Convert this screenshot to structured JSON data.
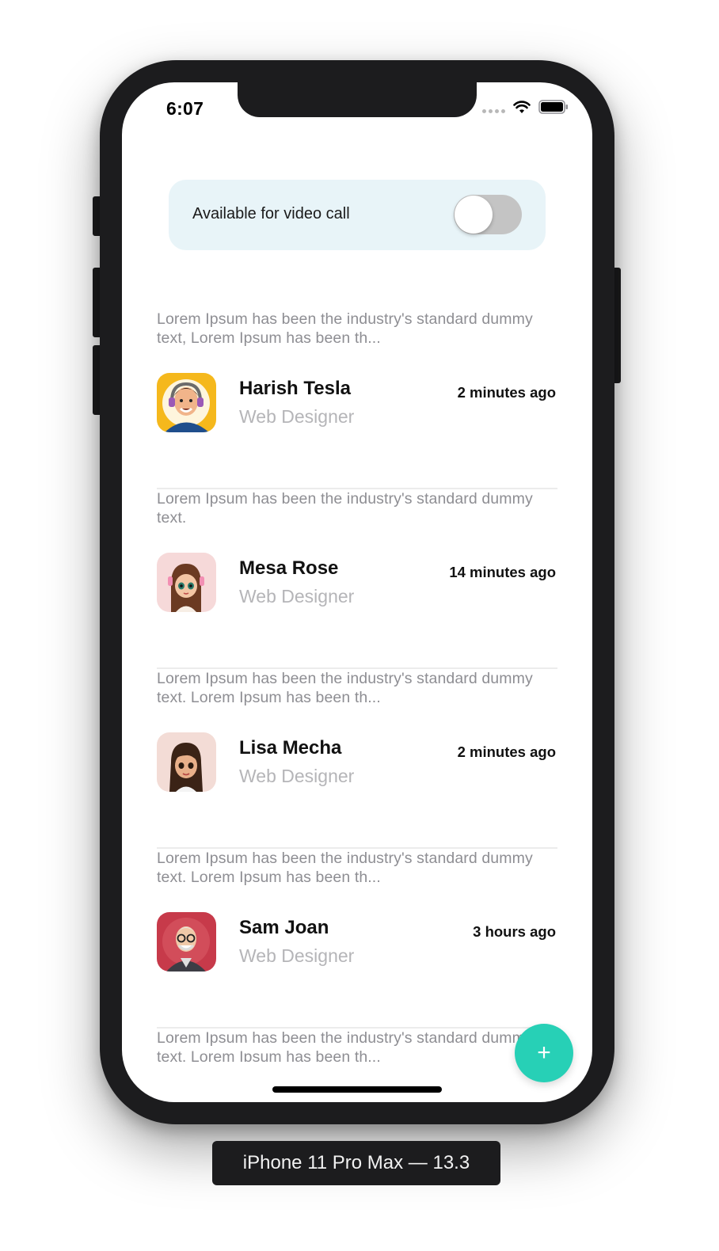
{
  "status_bar": {
    "time": "6:07",
    "icons": [
      "signal-dots-icon",
      "wifi-icon",
      "battery-icon"
    ]
  },
  "video_call_toggle": {
    "label": "Available for video call",
    "enabled": false
  },
  "feed": [
    {
      "preview": "Lorem Ipsum has been the industry's standard dummy text, Lorem Ipsum has been th...",
      "name": "Harish Tesla",
      "role": "Web Designer",
      "time": "2 minutes ago",
      "avatar": "avatar-man-headphones-icon"
    },
    {
      "preview": "Lorem Ipsum has been the industry's standard dummy text.",
      "name": "Mesa Rose",
      "role": "Web Designer",
      "time": "14 minutes ago",
      "avatar": "avatar-girl-headphones-icon"
    },
    {
      "preview": "Lorem Ipsum has been the industry's standard dummy text. Lorem Ipsum has been th...",
      "name": "Lisa Mecha",
      "role": "Web Designer",
      "time": "2 minutes ago",
      "avatar": "avatar-girl-icon"
    },
    {
      "preview": "Lorem Ipsum has been the industry's standard dummy text. Lorem Ipsum has been th...",
      "name": "Sam Joan",
      "role": "Web Designer",
      "time": "3 hours ago",
      "avatar": "avatar-man-glasses-icon"
    },
    {
      "preview": "Lorem Ipsum has been the industry's standard dummy text. Lorem Ipsum has been th..."
    }
  ],
  "fab": {
    "symbol": "+",
    "icon": "plus-icon"
  },
  "simulator_label": "iPhone 11 Pro Max — 13.3",
  "colors": {
    "accent": "#27d0b6",
    "toggle_card_bg": "#e8f4f8",
    "toggle_off": "#c4c4c4",
    "device": "#1c1c1e"
  }
}
